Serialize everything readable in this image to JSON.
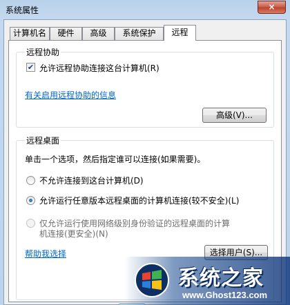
{
  "window": {
    "title": "系统属性",
    "close_glyph": "×"
  },
  "tabs": [
    {
      "label": "计算机名"
    },
    {
      "label": "硬件"
    },
    {
      "label": "高级"
    },
    {
      "label": "系统保护"
    },
    {
      "label": "远程"
    }
  ],
  "active_tab": "远程",
  "remote_assistance": {
    "group_title": "远程协助",
    "checkbox_label": "允许远程协助连接这台计算机(R)",
    "checkbox_checked": true,
    "info_link": "有关启用远程协助的信息",
    "advanced_button": "高级(V)..."
  },
  "remote_desktop": {
    "group_title": "远程桌面",
    "instruction": "单击一个选项，然后指定谁可以连接(如果需要)。",
    "options": [
      {
        "label": "不允许连接到这台计算机(D)",
        "checked": false,
        "enabled": true
      },
      {
        "label": "允许运行任意版本远程桌面的计算机连接(较不安全)(L)",
        "checked": true,
        "enabled": true
      },
      {
        "label": "仅允许运行使用网络级别身份验证的远程桌面的计算",
        "label2": "机连接(更安全)(N)",
        "checked": false,
        "enabled": false
      }
    ],
    "help_link": "帮助我选择",
    "select_users_button": "选择用户(S)..."
  },
  "watermark": {
    "title": "系统之家",
    "url": "www.Ghost123.com"
  },
  "colors": {
    "link": "#0066cc",
    "title_bar": "#b9d1ea",
    "close_button": "#c75a49",
    "watermark": "#14468c"
  },
  "icons": {
    "checkbox_check": "check-icon",
    "close": "close-icon",
    "logo": "windows-logo-icon"
  }
}
